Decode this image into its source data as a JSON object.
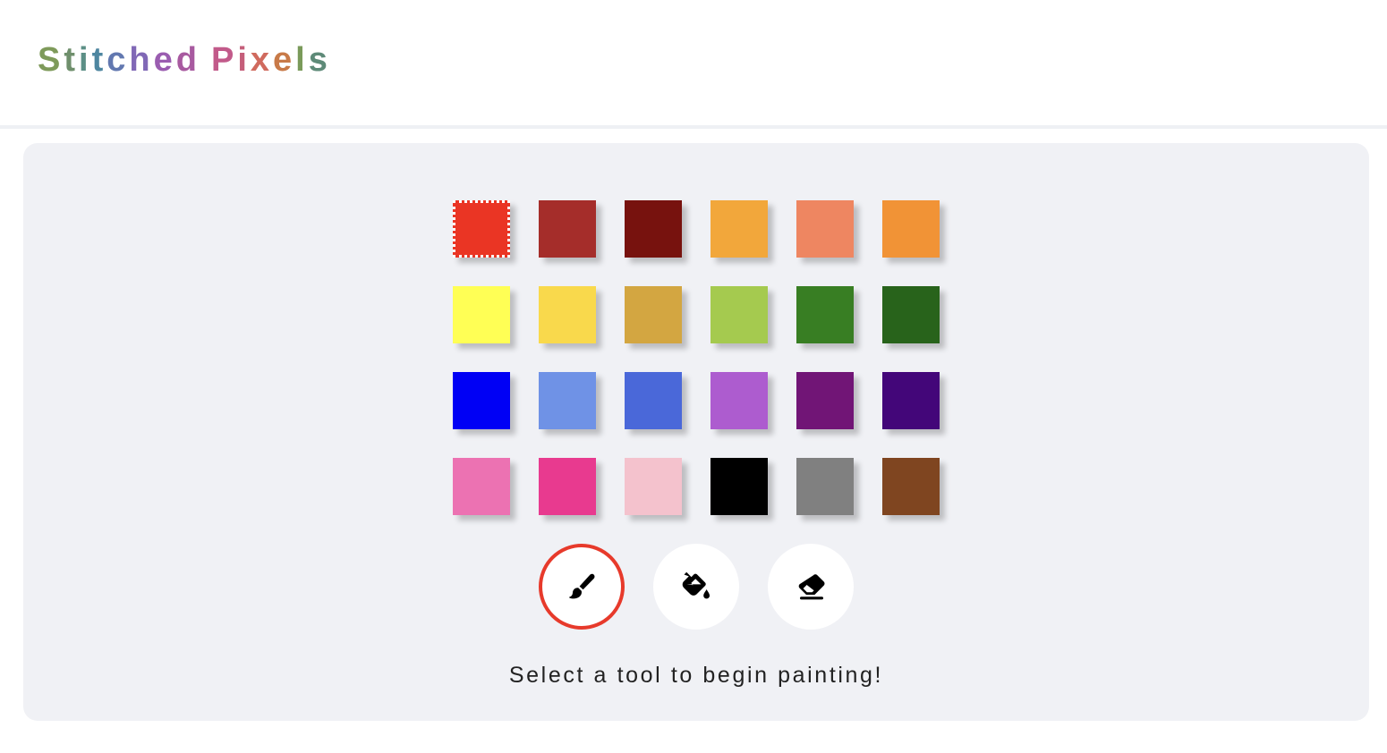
{
  "app": {
    "title": "Stitched Pixels",
    "title_colors": [
      "#7e9a5a",
      "#6f8f6c",
      "#5c8f86",
      "#4e86a0",
      "#6278b0",
      "#8068b6",
      "#9a5db0",
      "#a85aa0",
      "#c25a8a",
      "#c55e7a",
      "#d06a5e",
      "#c87a48",
      "#7a9a5a",
      "#5e8a78",
      "#58847a"
    ]
  },
  "palette": {
    "selected_index": 0,
    "colors": [
      "#ea3524",
      "#a52d2a",
      "#77120e",
      "#f2a73b",
      "#ee8661",
      "#f19336",
      "#ffff55",
      "#f9d94c",
      "#d3a641",
      "#a5ca4f",
      "#387e23",
      "#28631b",
      "#0000f5",
      "#6f92e6",
      "#4a68d9",
      "#ad5ccf",
      "#711576",
      "#430679",
      "#ec72b2",
      "#e83a8f",
      "#f4c2cd",
      "#000000",
      "#808080",
      "#7f4520"
    ]
  },
  "tools": [
    {
      "name": "brush",
      "icon": "paintbrush-icon",
      "active": true
    },
    {
      "name": "fill",
      "icon": "paint-bucket-icon",
      "active": false
    },
    {
      "name": "eraser",
      "icon": "eraser-icon",
      "active": false
    }
  ],
  "accent_color": "#e73a2b",
  "status": {
    "message": "Select a tool to begin painting!"
  }
}
